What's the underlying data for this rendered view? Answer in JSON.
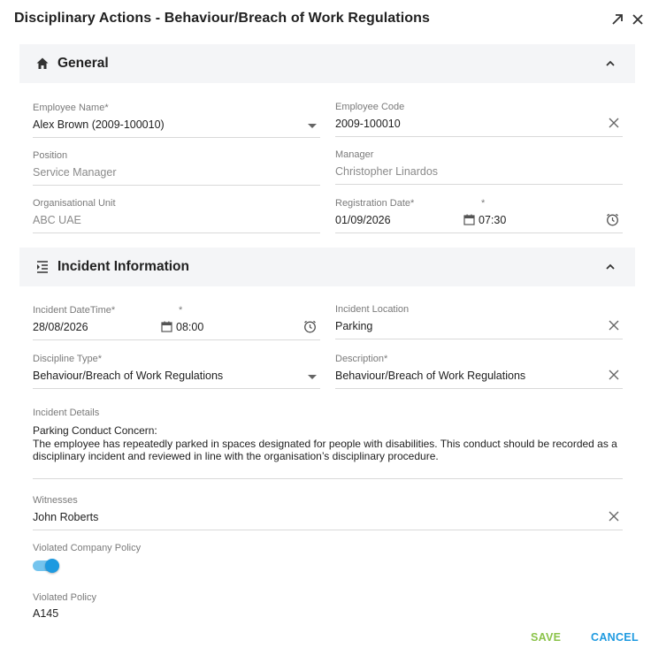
{
  "dialog": {
    "title": "Disciplinary Actions - Behaviour/Breach of Work Regulations"
  },
  "general": {
    "title": "General",
    "employee_name": {
      "label": "Employee Name*",
      "value": "Alex  Brown (2009-100010)"
    },
    "employee_code": {
      "label": "Employee Code",
      "value": "2009-100010"
    },
    "position": {
      "label": "Position",
      "value": "Service Manager"
    },
    "manager": {
      "label": "Manager",
      "value": "Christopher Linardos"
    },
    "org_unit": {
      "label": "Organisational Unit",
      "value": "ABC UAE"
    },
    "registration": {
      "label": "Registration Date*",
      "time_label": "*",
      "date": "01/09/2026",
      "time": "07:30"
    }
  },
  "incident": {
    "title": "Incident Information",
    "datetime": {
      "label": "Incident DateTime*",
      "time_label": "*",
      "date": "28/08/2026",
      "time": "08:00"
    },
    "location": {
      "label": "Incident Location",
      "value": "Parking"
    },
    "discipline_type": {
      "label": "Discipline Type*",
      "value": "Behaviour/Breach of Work Regulations"
    },
    "description": {
      "label": "Description*",
      "value": "Behaviour/Breach of Work Regulations"
    },
    "details": {
      "label": "Incident Details",
      "text": "Parking Conduct Concern:\nThe employee has repeatedly parked in spaces designated for people with disabilities. This conduct should be recorded as a disciplinary incident and reviewed in line with the organisation’s disciplinary procedure."
    },
    "witnesses": {
      "label": "Witnesses",
      "value": "John Roberts"
    },
    "violated_company_policy": {
      "label": "Violated Company Policy",
      "on": true
    },
    "violated_policy": {
      "label": "Violated Policy",
      "value": "A145"
    }
  },
  "footer": {
    "save": "SAVE",
    "cancel": "CANCEL"
  },
  "colors": {
    "accent": "#1e9ae0",
    "save": "#8bc34a",
    "section_bg": "#f4f5f7"
  },
  "icons": [
    "expand-icon",
    "close-icon",
    "home-icon",
    "list-icon",
    "chevron-up-icon",
    "calendar-icon",
    "clock-icon",
    "clear-icon",
    "dropdown-caret-icon"
  ]
}
